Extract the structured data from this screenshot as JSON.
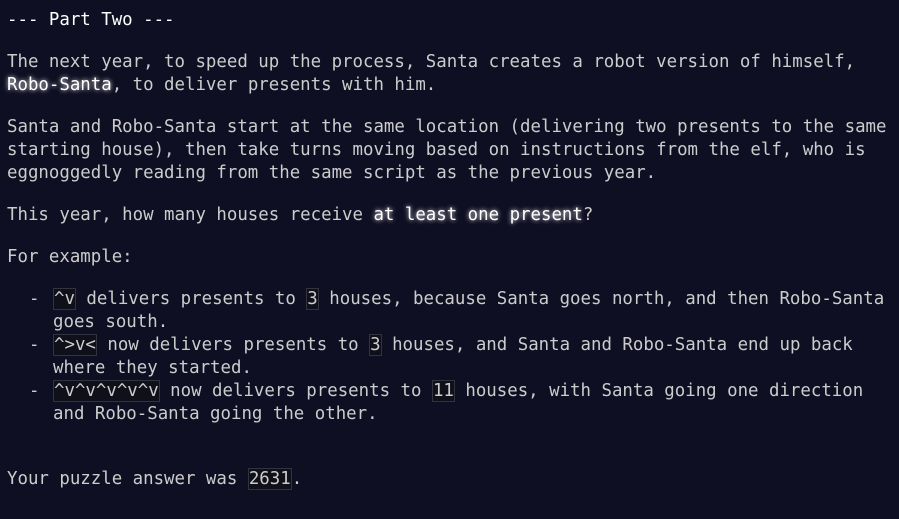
{
  "title": "--- Part Two ---",
  "p1": {
    "before": "The next year, to speed up the process, Santa creates a robot version of himself, ",
    "emph": "Robo-Santa",
    "after": ", to deliver presents with him."
  },
  "p2": "Santa and Robo-Santa start at the same location (delivering two presents to the same starting house), then take turns moving based on instructions from the elf, who is eggnoggedly reading from the same script as the previous year.",
  "p3": {
    "before": "This year, how many houses receive ",
    "emph": "at least one present",
    "after": "?"
  },
  "p4": "For example:",
  "examples": [
    {
      "code": "^v",
      "mid": " delivers presents to ",
      "count": "3",
      "after": " houses, because Santa goes north, and then Robo-Santa goes south."
    },
    {
      "code": "^>v<",
      "mid": " now delivers presents to ",
      "count": "3",
      "after": " houses, and Santa and Robo-Santa end up back where they started."
    },
    {
      "code": "^v^v^v^v^v",
      "mid": " now delivers presents to ",
      "count": "11",
      "after": " houses, with Santa going one direction and Robo-Santa going the other."
    }
  ],
  "answer": {
    "before": "Your puzzle answer was ",
    "value": "2631",
    "after": "."
  }
}
